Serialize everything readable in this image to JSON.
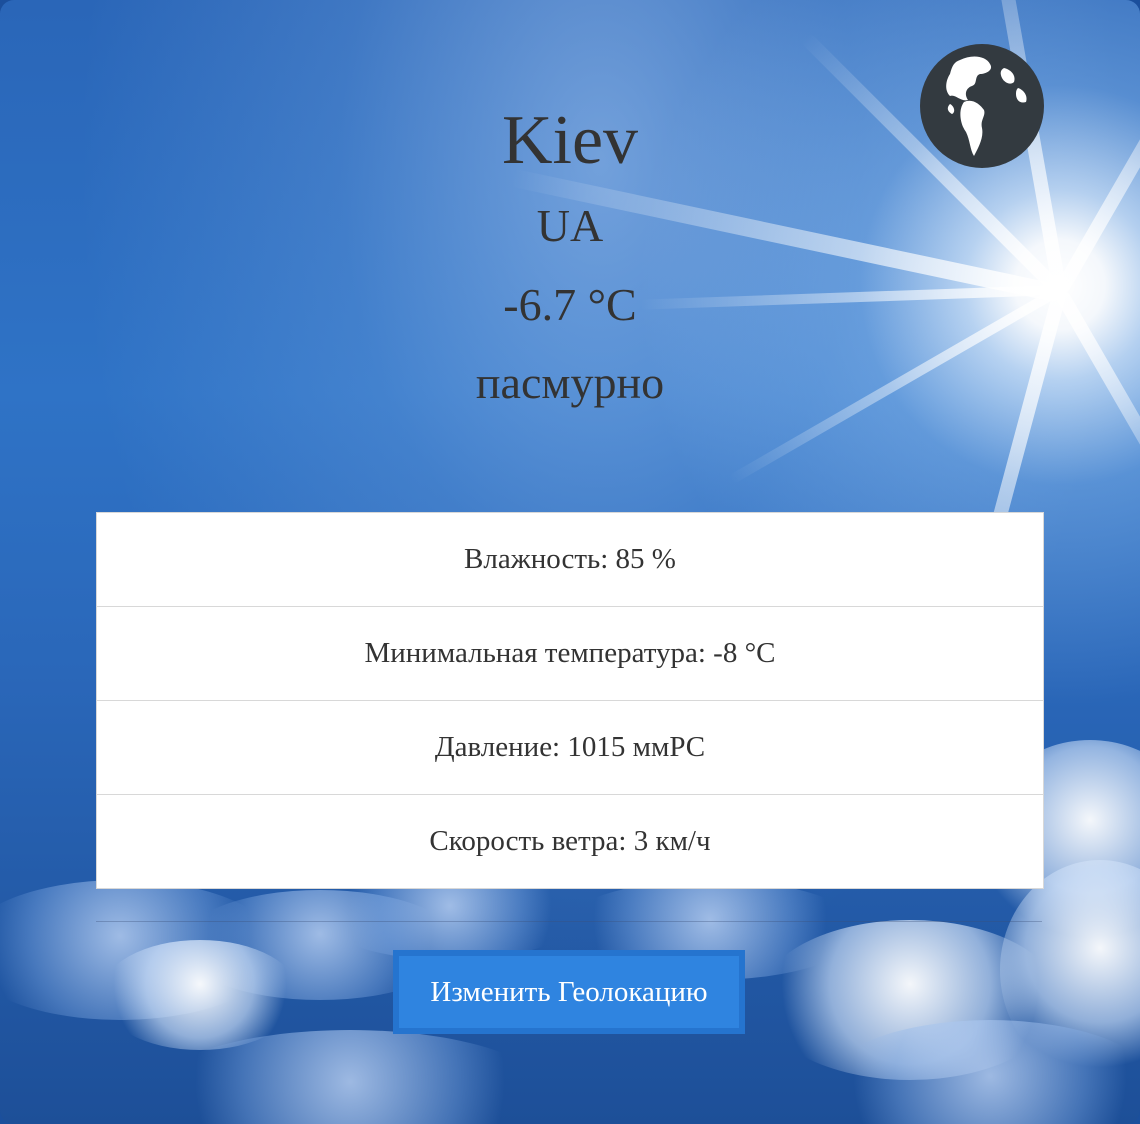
{
  "location": {
    "city": "Kiev",
    "country": "UA",
    "temperature": "-6.7 °C",
    "condition": "пасмурно"
  },
  "details": [
    {
      "text": "Влажность: 85 %"
    },
    {
      "text": "Минимальная температура: -8 °C"
    },
    {
      "text": "Давление: 1015 ммРС"
    },
    {
      "text": "Скорость ветра: 3 км/ч"
    }
  ],
  "actions": {
    "change_location_label": "Изменить Геолокацию",
    "globe_icon": "globe-icon"
  },
  "colors": {
    "text": "#333333",
    "button_bg": "#2f84e0",
    "button_border": "#2574cf",
    "globe": "#333a40"
  }
}
